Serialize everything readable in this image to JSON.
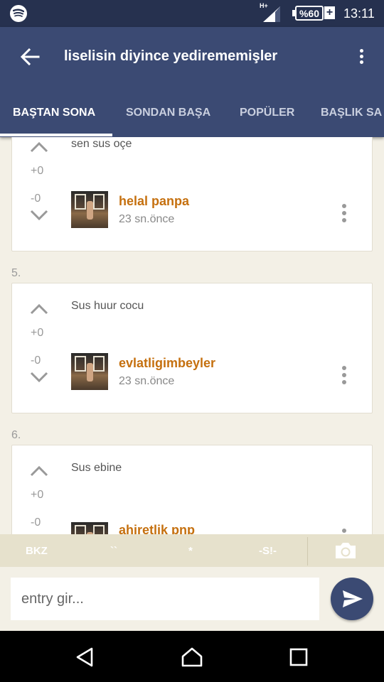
{
  "status_bar": {
    "network_label": "H+",
    "battery": "%60",
    "time": "13:11"
  },
  "app_bar": {
    "title": "liselisin diyince yedirememişler"
  },
  "tabs": [
    {
      "label": "BAŞTAN SONA",
      "active": true
    },
    {
      "label": "SONDAN BAŞA",
      "active": false
    },
    {
      "label": "POPÜLER",
      "active": false
    },
    {
      "label": "BAŞLIK SA",
      "active": false
    }
  ],
  "entries": [
    {
      "number": "",
      "text": "sen sus oçe",
      "up_count": "+0",
      "down_count": "-0",
      "author": "helal panpa",
      "time": "23 sn.önce"
    },
    {
      "number": "5.",
      "text": "Sus huur cocu",
      "up_count": "+0",
      "down_count": "-0",
      "author": "evlatligimbeyler",
      "time": "23 sn.önce"
    },
    {
      "number": "6.",
      "text": "Sus ebine",
      "up_count": "+0",
      "down_count": "-0",
      "author": "ahiretlik pnp",
      "time": ""
    }
  ],
  "format_bar": {
    "bkz": "BKZ",
    "backtick": "``",
    "star": "*",
    "spoiler": "-S!-"
  },
  "input": {
    "placeholder": "entry gir..."
  },
  "colors": {
    "primary": "#3b4a73",
    "status_bar": "#26314f",
    "author": "#c5700f",
    "background": "#f3f0e6"
  },
  "icons": [
    "spotify-icon",
    "signal-icon",
    "battery-icon",
    "back-arrow-icon",
    "more-vert-icon",
    "chevron-up-icon",
    "chevron-down-icon",
    "camera-icon",
    "send-icon",
    "nav-back-icon",
    "nav-home-icon",
    "nav-recents-icon"
  ]
}
